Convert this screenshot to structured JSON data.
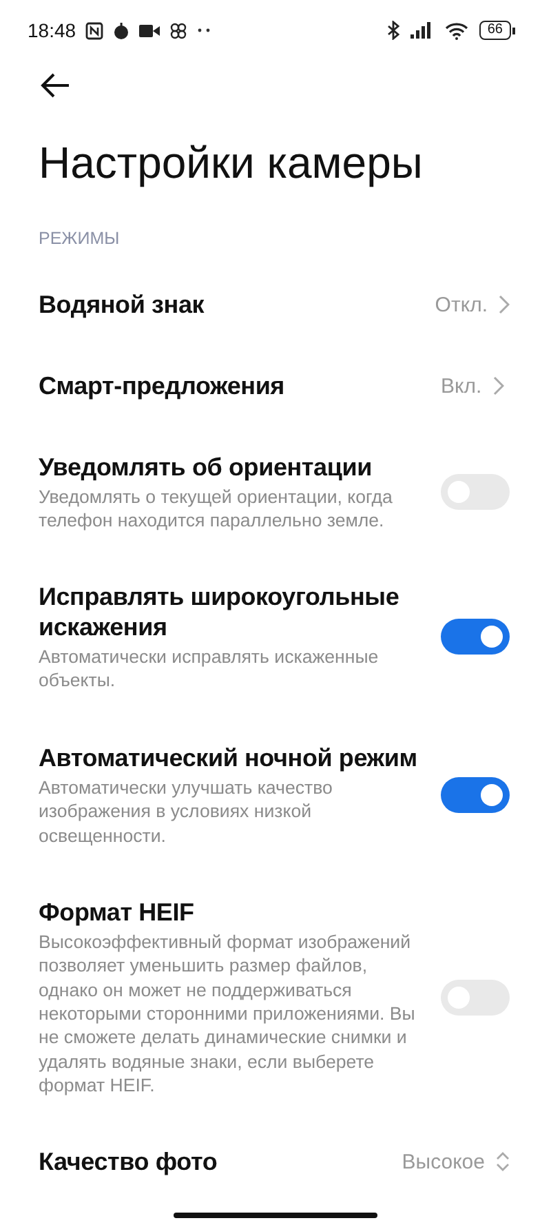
{
  "status_bar": {
    "time": "18:48",
    "battery": "66"
  },
  "title": "Настройки камеры",
  "section": "РЕЖИМЫ",
  "items": [
    {
      "kind": "link",
      "title": "Водяной знак",
      "value": "Откл."
    },
    {
      "kind": "link",
      "title": "Смарт-предложения",
      "value": "Вкл."
    },
    {
      "kind": "toggle",
      "title": "Уведомлять об ориентации",
      "subtitle": "Уведомлять о текущей ориентации, когда телефон находится параллельно земле.",
      "on": false
    },
    {
      "kind": "toggle",
      "title": "Исправлять широкоугольные искажения",
      "subtitle": "Автоматически исправлять искаженные объекты.",
      "on": true
    },
    {
      "kind": "toggle",
      "title": "Автоматический ночной режим",
      "subtitle": "Автоматически улучшать качество изображения в условиях низкой освещенности.",
      "on": true
    },
    {
      "kind": "toggle",
      "title": "Формат HEIF",
      "subtitle": "Высокоэффективный формат изображений позволяет уменьшить размер файлов, однако он может не поддерживаться некоторыми сторонними приложениями. Вы не сможете делать динамические снимки и удалять водяные знаки, если выберете формат HEIF.",
      "on": false
    },
    {
      "kind": "select",
      "title": "Качество фото",
      "value": "Высокое"
    }
  ]
}
